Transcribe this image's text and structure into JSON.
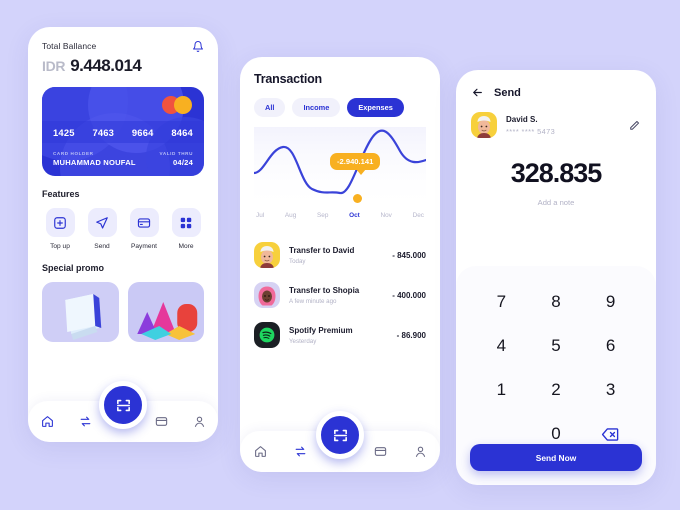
{
  "theme": {
    "background": "#d3d3fb",
    "primary": "#2b33d4",
    "accent_orange": "#f8b021",
    "card_bg": "#ffffff",
    "muted_text": "#b2b2c6"
  },
  "home": {
    "balance_label": "Total Ballance",
    "currency": "IDR",
    "balance_amount": "9.448.014",
    "bell_icon": "bell-icon",
    "card": {
      "number": "1425 7463 9664 8464",
      "number_groups": [
        "1425",
        "7463",
        "9664",
        "8464"
      ],
      "holder_label": "CARD HOLDER",
      "holder_name": "MUHAMMAD NOUFAL",
      "valid_label": "VALID THRU",
      "valid_value": "04/24",
      "brand_icon": "mastercard-icon"
    },
    "features_title": "Features",
    "features": [
      {
        "label": "Top up",
        "icon": "plus-square-icon"
      },
      {
        "label": "Send",
        "icon": "paper-plane-icon"
      },
      {
        "label": "Payment",
        "icon": "credit-card-icon"
      },
      {
        "label": "More",
        "icon": "grid-four-icon"
      }
    ],
    "promo_title": "Special promo",
    "promos": [
      {
        "name": "promo-card-book"
      },
      {
        "name": "promo-card-shapes"
      }
    ]
  },
  "transaction": {
    "title": "Transaction",
    "tabs": [
      {
        "label": "All",
        "active": false
      },
      {
        "label": "Income",
        "active": false
      },
      {
        "label": "Expenses",
        "active": true
      }
    ],
    "tooltip_value": "-2.940.141",
    "items": [
      {
        "name": "Transfer to David",
        "time": "Today",
        "amount": "- 845.000",
        "avatar": "avatar-david"
      },
      {
        "name": "Transfer to Shopia",
        "time": "A few minute ago",
        "amount": "- 400.000",
        "avatar": "avatar-shopia"
      },
      {
        "name": "Spotify Premium",
        "time": "Yesterday",
        "amount": "- 86.900",
        "avatar": "spotify-logo"
      }
    ]
  },
  "chart_data": {
    "type": "line",
    "title": "",
    "xlabel": "",
    "ylabel": "",
    "categories": [
      "Jul",
      "Aug",
      "Sep",
      "Oct",
      "Nov",
      "Dec"
    ],
    "values": [
      42,
      78,
      30,
      18,
      92,
      60
    ],
    "highlight_category": "Oct",
    "highlight_value": "-2.940.141",
    "grid": false,
    "legend": "none",
    "line_color": "#3a43d9",
    "marker_color": "#f8b021"
  },
  "send": {
    "title": "Send",
    "back_icon": "arrow-left-icon",
    "payee_name": "David S.",
    "payee_card": "**** **** 5473",
    "edit_icon": "pencil-icon",
    "amount": "328.835",
    "note_placeholder": "Add a note",
    "keypad": [
      "7",
      "8",
      "9",
      "4",
      "5",
      "6",
      "1",
      "2",
      "3",
      "",
      "0",
      "backspace"
    ],
    "backspace_icon": "backspace-icon",
    "submit_label": "Send Now"
  },
  "bottom_nav": {
    "items": [
      {
        "icon": "home-icon",
        "label": "Home"
      },
      {
        "icon": "transfer-arrows-icon",
        "label": "Transfer"
      },
      {
        "icon": "scan-icon",
        "label": "Scan"
      },
      {
        "icon": "card-icon",
        "label": "Card"
      },
      {
        "icon": "profile-icon",
        "label": "Profile"
      }
    ]
  }
}
